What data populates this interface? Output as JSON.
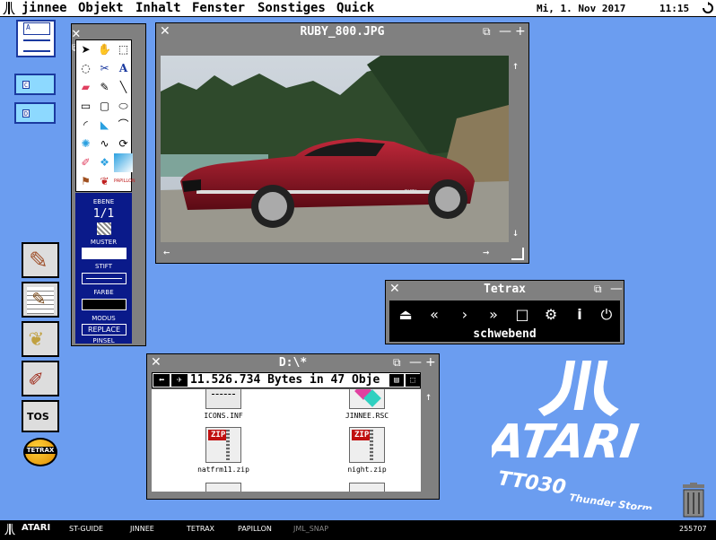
{
  "menubar": {
    "items": [
      "jinnee",
      "Objekt",
      "Inhalt",
      "Fenster",
      "Sonstiges",
      "Quick"
    ],
    "date": "Mi, 1. Nov 2017",
    "time": "11:15"
  },
  "desktop": {
    "floppy_label": "A",
    "drive_c_label": "C",
    "drive_d_label": "D",
    "tos_label": "TOS",
    "tetrax_label": "TETRAX"
  },
  "tool_palette": {
    "ebene_label": "EBENE",
    "ebene_value": "1/1",
    "muster_label": "MUSTER",
    "stift_label": "STIFT",
    "farbe_label": "FARBE",
    "modus_label": "MODUS",
    "modus_value": "REPLACE",
    "pinsel_label": "PINSEL",
    "text_tool": "A",
    "papillon_mini": "PAPILLON"
  },
  "image_window": {
    "title": "RUBY_800.JPG",
    "car_badge": "RUBY"
  },
  "tetrax_window": {
    "title": "Tetrax",
    "status": "schwebend"
  },
  "dir_window": {
    "title": "D:\\*",
    "info": "11.526.734 Bytes in 47 Obje",
    "files": [
      {
        "name": "ICONS.INF",
        "icon": "document-icon"
      },
      {
        "name": "JINNEE.RSC",
        "icon": "resource-icon"
      },
      {
        "name": "natfrm11.zip",
        "icon": "zip-icon",
        "badge": "ZIP"
      },
      {
        "name": "night.zip",
        "icon": "zip-icon",
        "badge": "ZIP"
      }
    ]
  },
  "atari_logo": {
    "brand": "ATARI",
    "model": "TT030",
    "tagline": "Thunder Storm"
  },
  "taskbar": {
    "start": "ATARI",
    "items": [
      "ST-GUIDE",
      "JINNEE",
      "TETRAX",
      "PAPILLON",
      "JML_SNAP"
    ],
    "memory": "255707"
  },
  "colors": {
    "desktop": "#6b9df0",
    "window_gray": "#808080",
    "palette_blue": "#0a1a8a"
  }
}
